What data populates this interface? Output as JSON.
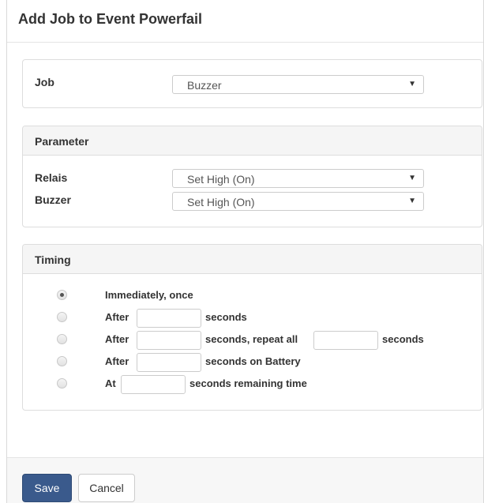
{
  "modal": {
    "title": "Add Job to Event Powerfail"
  },
  "job_panel": {
    "label": "Job",
    "selected": "Buzzer"
  },
  "parameter_panel": {
    "heading": "Parameter",
    "rows": [
      {
        "label": "Relais",
        "selected": "Set High (On)"
      },
      {
        "label": "Buzzer",
        "selected": "Set High (On)"
      }
    ]
  },
  "timing_panel": {
    "heading": "Timing",
    "selected_option": "Immediately, once",
    "opt1": {
      "text": "Immediately, once"
    },
    "opt2": {
      "prefix": "After",
      "suffix": "seconds",
      "value": ""
    },
    "opt3": {
      "prefix": "After",
      "middle": "seconds, repeat all",
      "suffix": "seconds",
      "value1": "",
      "value2": ""
    },
    "opt4": {
      "prefix": "After",
      "suffix": "seconds on Battery",
      "value": ""
    },
    "opt5": {
      "prefix": "At",
      "suffix": "seconds remaining time",
      "value": ""
    }
  },
  "footer": {
    "save_label": "Save",
    "cancel_label": "Cancel"
  },
  "colors": {
    "primary_button": "#3a5a8c",
    "panel_heading_bg": "#f5f5f5",
    "footer_bg": "#f7f7f7"
  }
}
